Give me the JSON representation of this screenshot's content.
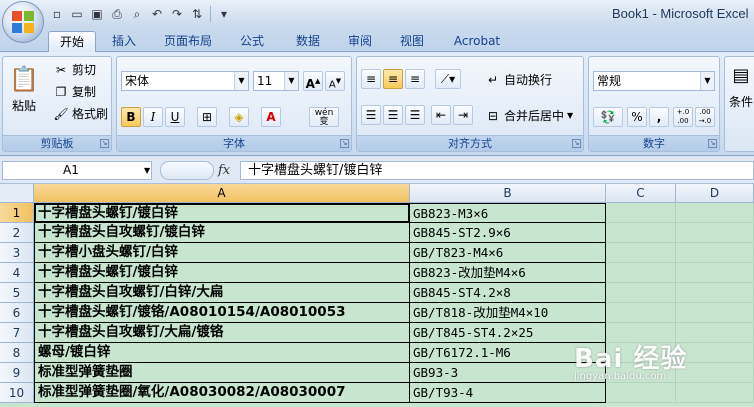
{
  "window": {
    "title": "Book1 - Microsoft Excel"
  },
  "quick_access": [
    "save-icon",
    "open-icon",
    "new-icon",
    "print-icon",
    "print-preview-icon",
    "undo-icon",
    "redo-icon",
    "customize-icon"
  ],
  "tabs": [
    {
      "label": "开始",
      "active": true
    },
    {
      "label": "插入"
    },
    {
      "label": "页面布局"
    },
    {
      "label": "公式"
    },
    {
      "label": "数据"
    },
    {
      "label": "审阅"
    },
    {
      "label": "视图"
    },
    {
      "label": "Acrobat"
    }
  ],
  "ribbon": {
    "clipboard": {
      "label": "剪贴板",
      "paste": "粘贴",
      "cut": "剪切",
      "copy": "复制",
      "format_painter": "格式刷"
    },
    "font": {
      "label": "字体",
      "name": "宋体",
      "size": "11",
      "bold": "B",
      "italic": "I",
      "underline": "U",
      "font_color": "A",
      "phonetic": "wén 变"
    },
    "alignment": {
      "label": "对齐方式",
      "wrap": "自动换行",
      "merge": "合并后居中"
    },
    "number": {
      "label": "数字",
      "format": "常规",
      "percent": "%",
      "comma": ",",
      "inc_decimal": "+.0 .00",
      "dec_decimal": ".00 →.0"
    },
    "styles": {
      "label": "条件"
    }
  },
  "formula_bar": {
    "name_box": "A1",
    "fx": "fx",
    "content": "十字槽盘头螺钉/镀白锌"
  },
  "grid": {
    "columns": [
      "A",
      "B",
      "C",
      "D"
    ],
    "selected_column": "A",
    "rows": [
      {
        "num": "1",
        "a": "十字槽盘头螺钉/镀白锌",
        "b": "GB823-M3×6"
      },
      {
        "num": "2",
        "a": "十字槽盘头自攻螺钉/镀白锌",
        "b": "GB845-ST2.9×6"
      },
      {
        "num": "3",
        "a": "十字槽小盘头螺钉/白锌",
        "b": "GB/T823-M4×6"
      },
      {
        "num": "4",
        "a": "十字槽盘头螺钉/镀白锌",
        "b": "GB823-改加垫M4×6"
      },
      {
        "num": "5",
        "a": "十字槽盘头自攻螺钉/白锌/大扁",
        "b": "GB845-ST4.2×8"
      },
      {
        "num": "6",
        "a": "十字槽盘头螺钉/镀铬/A08010154/A08010053",
        "b": "GB/T818-改加垫M4×10"
      },
      {
        "num": "7",
        "a": "十字槽盘头自攻螺钉/大扁/镀铬",
        "b": "GB/T845-ST4.2×25"
      },
      {
        "num": "8",
        "a": "螺母/镀白锌",
        "b": "GB/T6172.1-M6"
      },
      {
        "num": "9",
        "a": "标准型弹簧垫圈",
        "b": "GB93-3"
      },
      {
        "num": "10",
        "a": "标准型弹簧垫圈/氧化/A08030082/A08030007",
        "b": "GB/T93-4"
      }
    ]
  },
  "watermark": {
    "main": "Bai 经验",
    "sub": "jingyan.baidu.com"
  },
  "colors": {
    "sheet_fill": "#c8e6cf",
    "ribbon_bg": "#dbe7f5",
    "selection": "#f1c15f"
  }
}
